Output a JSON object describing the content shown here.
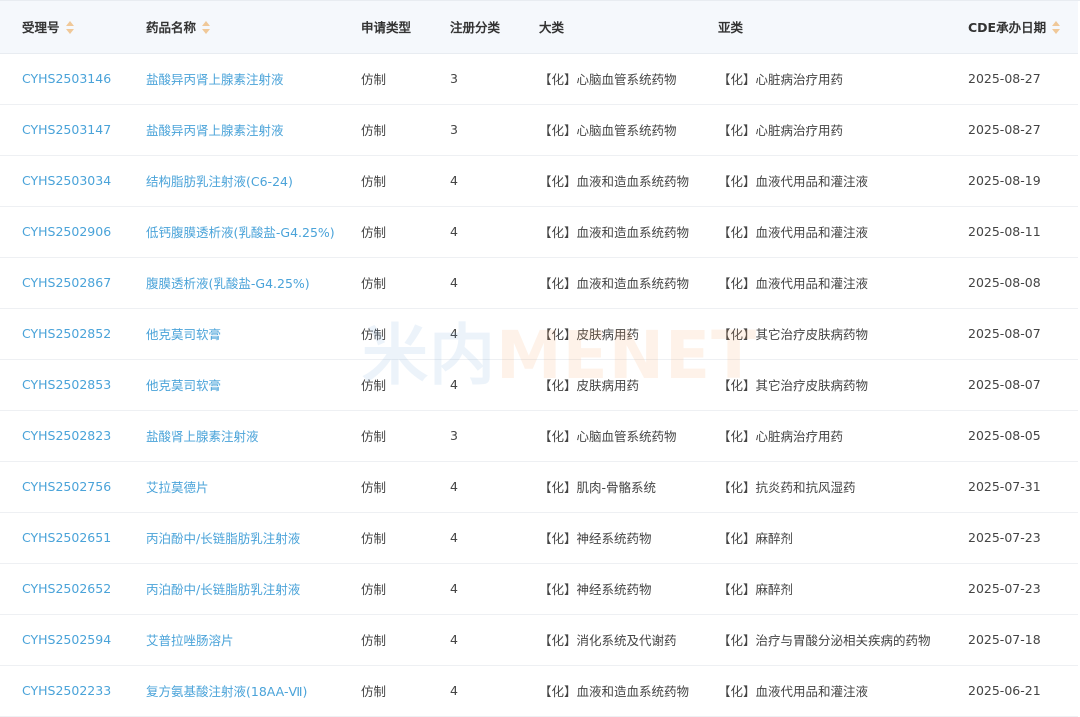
{
  "headers": {
    "accept_no": "受理号",
    "drug_name": "药品名称",
    "apply_type": "申请类型",
    "reg_class": "注册分类",
    "category": "大类",
    "subcategory": "亚类",
    "cde_date": "CDE承办日期"
  },
  "rows": [
    {
      "accept_no": "CYHS2503146",
      "drug_name": "盐酸异丙肾上腺素注射液",
      "apply_type": "仿制",
      "reg_class": "3",
      "category": "【化】心脑血管系统药物",
      "subcategory": "【化】心脏病治疗用药",
      "cde_date": "2025-08-27"
    },
    {
      "accept_no": "CYHS2503147",
      "drug_name": "盐酸异丙肾上腺素注射液",
      "apply_type": "仿制",
      "reg_class": "3",
      "category": "【化】心脑血管系统药物",
      "subcategory": "【化】心脏病治疗用药",
      "cde_date": "2025-08-27"
    },
    {
      "accept_no": "CYHS2503034",
      "drug_name": "结构脂肪乳注射液(C6-24)",
      "apply_type": "仿制",
      "reg_class": "4",
      "category": "【化】血液和造血系统药物",
      "subcategory": "【化】血液代用品和灌注液",
      "cde_date": "2025-08-19"
    },
    {
      "accept_no": "CYHS2502906",
      "drug_name": "低钙腹膜透析液(乳酸盐-G4.25%)",
      "apply_type": "仿制",
      "reg_class": "4",
      "category": "【化】血液和造血系统药物",
      "subcategory": "【化】血液代用品和灌注液",
      "cde_date": "2025-08-11"
    },
    {
      "accept_no": "CYHS2502867",
      "drug_name": "腹膜透析液(乳酸盐-G4.25%)",
      "apply_type": "仿制",
      "reg_class": "4",
      "category": "【化】血液和造血系统药物",
      "subcategory": "【化】血液代用品和灌注液",
      "cde_date": "2025-08-08"
    },
    {
      "accept_no": "CYHS2502852",
      "drug_name": "他克莫司软膏",
      "apply_type": "仿制",
      "reg_class": "4",
      "category": "【化】皮肤病用药",
      "subcategory": "【化】其它治疗皮肤病药物",
      "cde_date": "2025-08-07"
    },
    {
      "accept_no": "CYHS2502853",
      "drug_name": "他克莫司软膏",
      "apply_type": "仿制",
      "reg_class": "4",
      "category": "【化】皮肤病用药",
      "subcategory": "【化】其它治疗皮肤病药物",
      "cde_date": "2025-08-07"
    },
    {
      "accept_no": "CYHS2502823",
      "drug_name": "盐酸肾上腺素注射液",
      "apply_type": "仿制",
      "reg_class": "3",
      "category": "【化】心脑血管系统药物",
      "subcategory": "【化】心脏病治疗用药",
      "cde_date": "2025-08-05"
    },
    {
      "accept_no": "CYHS2502756",
      "drug_name": "艾拉莫德片",
      "apply_type": "仿制",
      "reg_class": "4",
      "category": "【化】肌肉-骨骼系统",
      "subcategory": "【化】抗炎药和抗风湿药",
      "cde_date": "2025-07-31"
    },
    {
      "accept_no": "CYHS2502651",
      "drug_name": "丙泊酚中/长链脂肪乳注射液",
      "apply_type": "仿制",
      "reg_class": "4",
      "category": "【化】神经系统药物",
      "subcategory": "【化】麻醉剂",
      "cde_date": "2025-07-23"
    },
    {
      "accept_no": "CYHS2502652",
      "drug_name": "丙泊酚中/长链脂肪乳注射液",
      "apply_type": "仿制",
      "reg_class": "4",
      "category": "【化】神经系统药物",
      "subcategory": "【化】麻醉剂",
      "cde_date": "2025-07-23"
    },
    {
      "accept_no": "CYHS2502594",
      "drug_name": "艾普拉唑肠溶片",
      "apply_type": "仿制",
      "reg_class": "4",
      "category": "【化】消化系统及代谢药",
      "subcategory": "【化】治疗与胃酸分泌相关疾病的药物",
      "cde_date": "2025-07-18"
    },
    {
      "accept_no": "CYHS2502233",
      "drug_name": "复方氨基酸注射液(18AA-Ⅶ)",
      "apply_type": "仿制",
      "reg_class": "4",
      "category": "【化】血液和造血系统药物",
      "subcategory": "【化】血液代用品和灌注液",
      "cde_date": "2025-06-21"
    }
  ],
  "watermark": {
    "cn": "米内",
    "en": "MENET"
  },
  "colors": {
    "link": "#4aa3d9",
    "header_bg": "#f5f8fc",
    "sort_icon": "#f0c898"
  }
}
